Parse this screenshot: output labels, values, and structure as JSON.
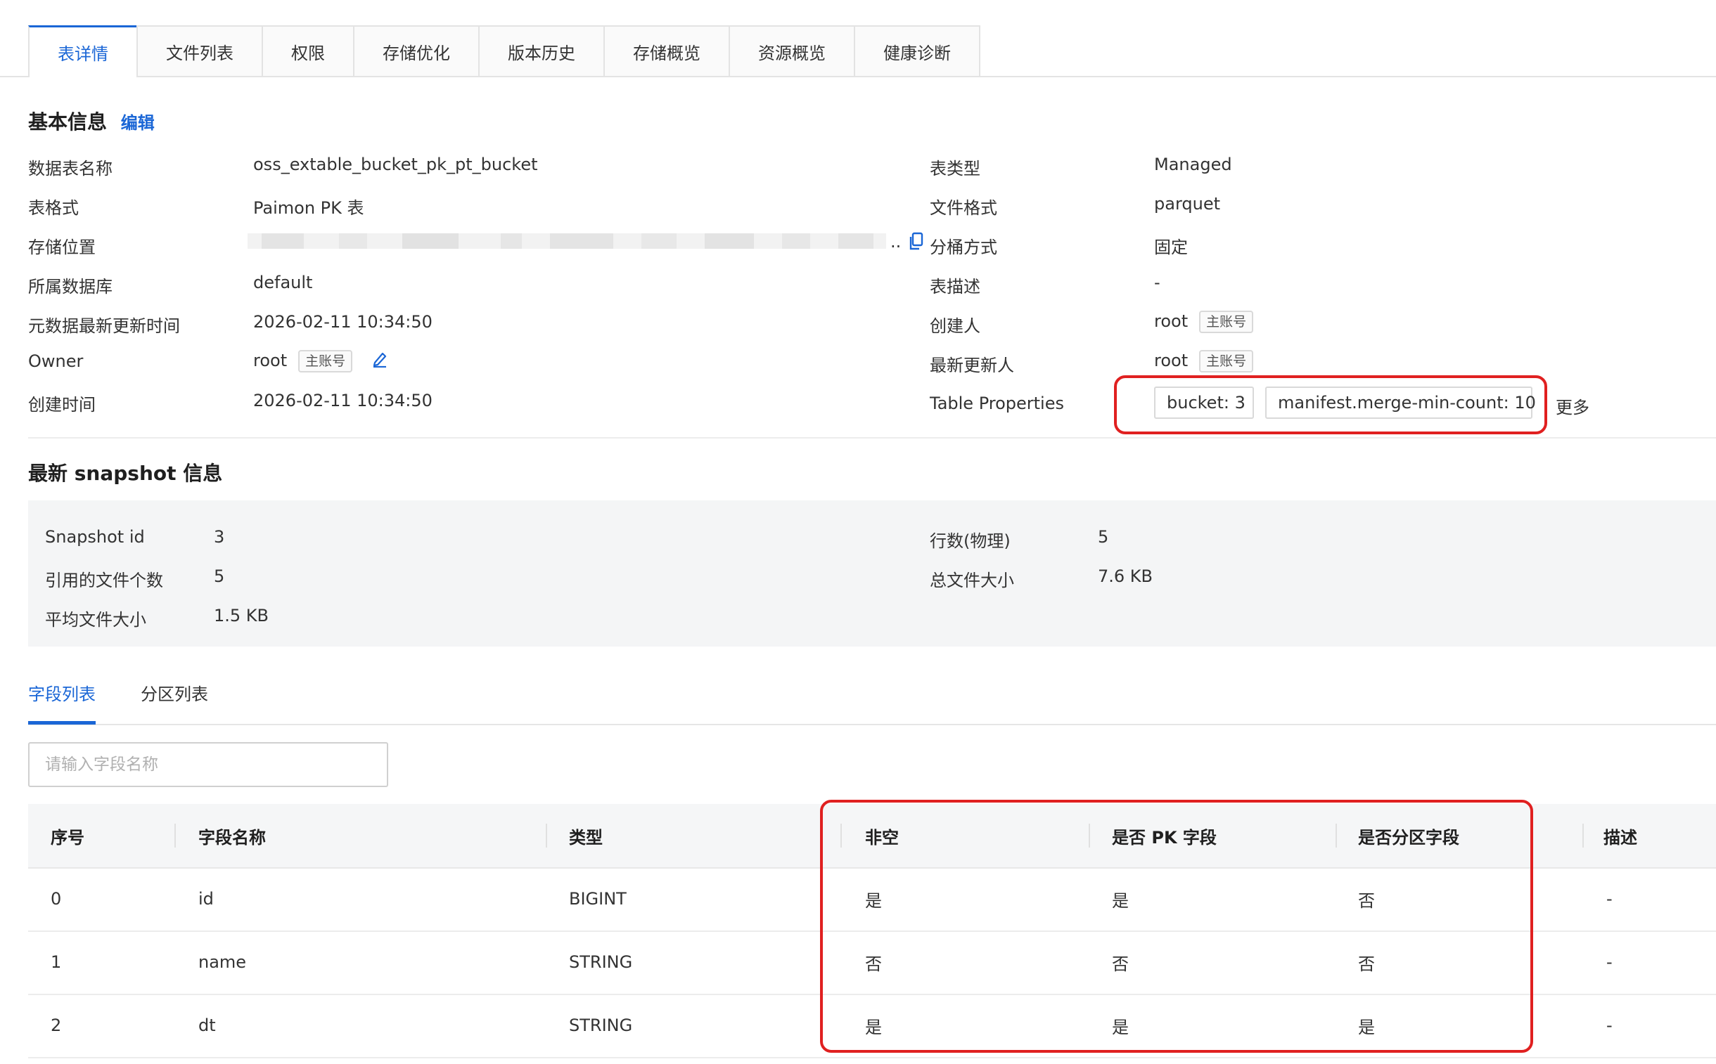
{
  "tabs": [
    {
      "label": "表详情",
      "active": true
    },
    {
      "label": "文件列表",
      "active": false
    },
    {
      "label": "权限",
      "active": false
    },
    {
      "label": "存储优化",
      "active": false
    },
    {
      "label": "版本历史",
      "active": false
    },
    {
      "label": "存储概览",
      "active": false
    },
    {
      "label": "资源概览",
      "active": false
    },
    {
      "label": "健康诊断",
      "active": false
    }
  ],
  "basic_info": {
    "title": "基本信息",
    "edit_label": "编辑",
    "left": [
      {
        "label": "数据表名称",
        "value": "oss_extable_bucket_pk_pt_bucket"
      },
      {
        "label": "表格式",
        "value": "Paimon PK 表"
      },
      {
        "label": "存储位置",
        "value": ".."
      },
      {
        "label": "所属数据库",
        "value": "default"
      },
      {
        "label": "元数据最新更新时间",
        "value": "2026-02-11 10:34:50"
      },
      {
        "label": "Owner",
        "value": "root",
        "badge": "主账号"
      },
      {
        "label": "创建时间",
        "value": "2026-02-11 10:34:50"
      }
    ],
    "right": [
      {
        "label": "表类型",
        "value": "Managed"
      },
      {
        "label": "文件格式",
        "value": "parquet"
      },
      {
        "label": "分桶方式",
        "value": "固定"
      },
      {
        "label": "表描述",
        "value": "-"
      },
      {
        "label": "创建人",
        "value": "root",
        "badge": "主账号"
      },
      {
        "label": "最新更新人",
        "value": "root",
        "badge": "主账号"
      }
    ],
    "table_properties": {
      "label": "Table Properties",
      "items": [
        "bucket: 3",
        "manifest.merge-min-count: 10"
      ],
      "more_label": "更多"
    }
  },
  "snapshot": {
    "title": "最新 snapshot 信息",
    "left": [
      {
        "label": "Snapshot id",
        "value": "3"
      },
      {
        "label": "引用的文件个数",
        "value": "5"
      },
      {
        "label": "平均文件大小",
        "value": "1.5 KB"
      }
    ],
    "right": [
      {
        "label": "行数(物理)",
        "value": "5"
      },
      {
        "label": "总文件大小",
        "value": "7.6 KB"
      }
    ]
  },
  "sub_tabs": [
    {
      "label": "字段列表",
      "active": true
    },
    {
      "label": "分区列表",
      "active": false
    }
  ],
  "search": {
    "placeholder": "请输入字段名称",
    "value": ""
  },
  "table": {
    "headers": [
      "序号",
      "字段名称",
      "类型",
      "非空",
      "是否 PK 字段",
      "是否分区字段",
      "描述"
    ],
    "rows": [
      [
        "0",
        "id",
        "BIGINT",
        "是",
        "是",
        "否",
        "-"
      ],
      [
        "1",
        "name",
        "STRING",
        "否",
        "否",
        "否",
        "-"
      ],
      [
        "2",
        "dt",
        "STRING",
        "是",
        "是",
        "是",
        "-"
      ]
    ]
  },
  "colors": {
    "accent": "#1a66d6",
    "highlight_box": "#e02020",
    "snapshot_bg": "#f4f5f6",
    "table_header_bg": "#f5f6f7"
  },
  "icons": [
    "copy-icon",
    "edit-pencil-icon"
  ]
}
